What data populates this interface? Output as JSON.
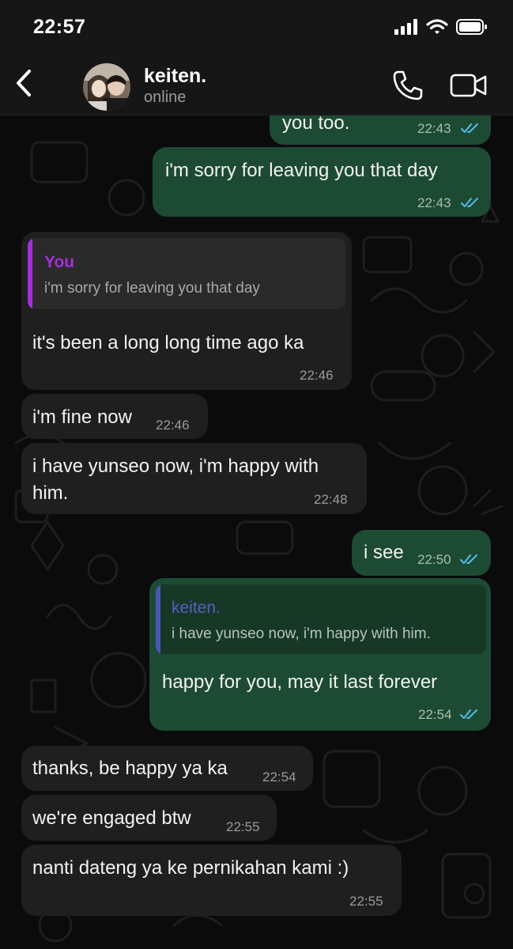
{
  "status_bar": {
    "time": "22:57"
  },
  "header": {
    "contact_name": "keiten.",
    "contact_status": "online"
  },
  "messages": [
    {
      "direction": "out",
      "text": "you too.",
      "time": "22:43",
      "read": true
    },
    {
      "direction": "out",
      "text": "i'm sorry for leaving you that day",
      "time": "22:43",
      "read": true
    },
    {
      "direction": "in",
      "quote_author": "You",
      "quote_text": "i'm sorry for leaving you that day",
      "text": "it's been a long long time ago ka",
      "time": "22:46"
    },
    {
      "direction": "in",
      "text": "i'm fine now",
      "time": "22:46"
    },
    {
      "direction": "in",
      "text_line1": "i have yunseo now, i'm happy with",
      "text_line2": "him.",
      "time": "22:48"
    },
    {
      "direction": "out",
      "text": "i see",
      "time": "22:50",
      "read": true
    },
    {
      "direction": "out",
      "quote_author": "keiten.",
      "quote_text": "i have yunseo now, i'm happy with him.",
      "text": "happy for you, may it last forever",
      "time": "22:54",
      "read": true
    },
    {
      "direction": "in",
      "text": "thanks, be happy ya ka",
      "time": "22:54"
    },
    {
      "direction": "in",
      "text": "we're engaged btw",
      "time": "22:55"
    },
    {
      "direction": "in",
      "text": "nanti dateng ya ke pernikahan kami :)",
      "time": "22:55"
    }
  ],
  "colors": {
    "outgoing_bubble": "#1d4a33",
    "incoming_bubble": "#1f1f1f",
    "read_ticks": "#53bdeb",
    "quote_you_accent": "#a42fd9",
    "quote_contact_accent": "#4a56b3"
  },
  "icons": [
    "back-chevron-icon",
    "phone-icon",
    "video-camera-icon",
    "signal-icon",
    "wifi-icon",
    "battery-icon",
    "double-check-icon"
  ]
}
